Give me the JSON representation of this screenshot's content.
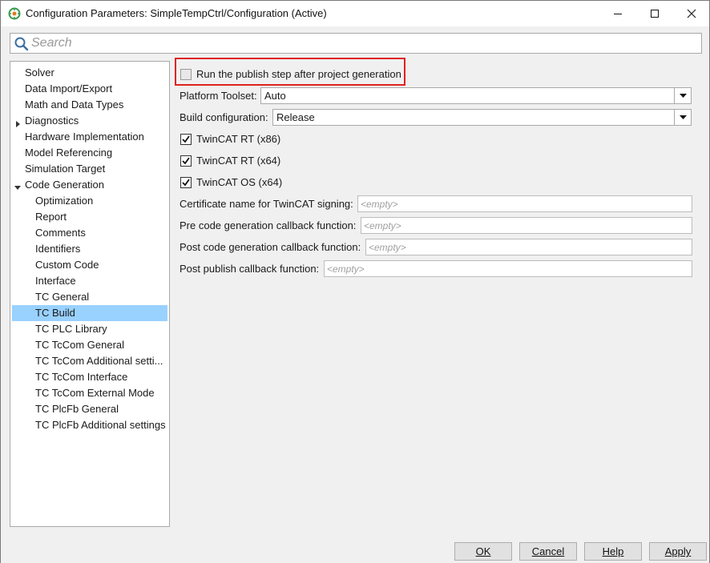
{
  "window": {
    "title": "Configuration Parameters: SimpleTempCtrl/Configuration (Active)"
  },
  "search": {
    "placeholder": "Search"
  },
  "tree": {
    "items": [
      {
        "label": "Solver",
        "level": 0,
        "expander": "none",
        "selected": false
      },
      {
        "label": "Data Import/Export",
        "level": 0,
        "expander": "none",
        "selected": false
      },
      {
        "label": "Math and Data Types",
        "level": 0,
        "expander": "none",
        "selected": false
      },
      {
        "label": "Diagnostics",
        "level": 0,
        "expander": "collapsed",
        "selected": false
      },
      {
        "label": "Hardware Implementation",
        "level": 0,
        "expander": "none",
        "selected": false
      },
      {
        "label": "Model Referencing",
        "level": 0,
        "expander": "none",
        "selected": false
      },
      {
        "label": "Simulation Target",
        "level": 0,
        "expander": "none",
        "selected": false
      },
      {
        "label": "Code Generation",
        "level": 0,
        "expander": "expanded",
        "selected": false
      },
      {
        "label": "Optimization",
        "level": 1,
        "expander": "none",
        "selected": false
      },
      {
        "label": "Report",
        "level": 1,
        "expander": "none",
        "selected": false
      },
      {
        "label": "Comments",
        "level": 1,
        "expander": "none",
        "selected": false
      },
      {
        "label": "Identifiers",
        "level": 1,
        "expander": "none",
        "selected": false
      },
      {
        "label": "Custom Code",
        "level": 1,
        "expander": "none",
        "selected": false
      },
      {
        "label": "Interface",
        "level": 1,
        "expander": "none",
        "selected": false
      },
      {
        "label": "TC General",
        "level": 1,
        "expander": "none",
        "selected": false
      },
      {
        "label": "TC Build",
        "level": 1,
        "expander": "none",
        "selected": true
      },
      {
        "label": "TC PLC Library",
        "level": 1,
        "expander": "none",
        "selected": false
      },
      {
        "label": "TC TcCom General",
        "level": 1,
        "expander": "none",
        "selected": false
      },
      {
        "label": "TC TcCom Additional setti...",
        "level": 1,
        "expander": "none",
        "selected": false
      },
      {
        "label": "TC TcCom Interface",
        "level": 1,
        "expander": "none",
        "selected": false
      },
      {
        "label": "TC TcCom External Mode",
        "level": 1,
        "expander": "none",
        "selected": false
      },
      {
        "label": "TC PlcFb General",
        "level": 1,
        "expander": "none",
        "selected": false
      },
      {
        "label": "TC PlcFb Additional settings",
        "level": 1,
        "expander": "none",
        "selected": false
      }
    ]
  },
  "panel": {
    "publish_step": {
      "label": "Run the publish step after project generation",
      "checked": false
    },
    "platform_toolset": {
      "label": "Platform Toolset:",
      "value": "Auto"
    },
    "build_configuration": {
      "label": "Build configuration:",
      "value": "Release"
    },
    "targets": [
      {
        "label": "TwinCAT RT (x86)",
        "checked": true
      },
      {
        "label": "TwinCAT RT (x64)",
        "checked": true
      },
      {
        "label": "TwinCAT OS (x64)",
        "checked": true
      }
    ],
    "fields": [
      {
        "label": "Certificate name for TwinCAT signing:",
        "placeholder": "<empty>"
      },
      {
        "label": "Pre code generation callback function:",
        "placeholder": "<empty>"
      },
      {
        "label": "Post code generation callback function:",
        "placeholder": "<empty>"
      },
      {
        "label": "Post publish callback function:",
        "placeholder": "<empty>"
      }
    ]
  },
  "buttons": {
    "ok": "OK",
    "cancel": "Cancel",
    "help": "Help",
    "apply": "Apply"
  },
  "colors": {
    "selection": "#99d1ff",
    "highlight_border": "#e02020"
  }
}
